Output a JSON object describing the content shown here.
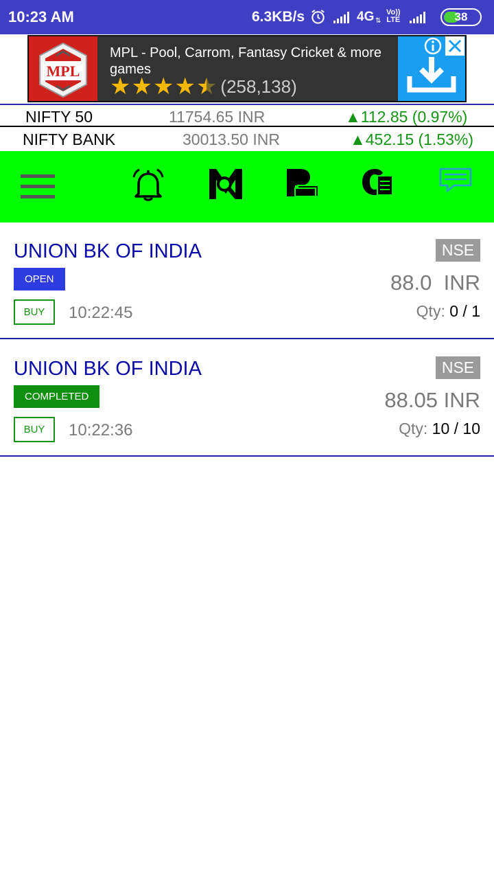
{
  "status_bar": {
    "time": "10:23 AM",
    "speed": "6.3KB/s",
    "network": "4G",
    "volte_line1": "Vo))",
    "volte_line2": "LTE",
    "battery": "38"
  },
  "ad": {
    "title": "MPL - Pool, Carrom, Fantasy Cricket & more games",
    "rating": 4.5,
    "rating_count": "(258,138)",
    "logo_text": "MPL"
  },
  "indices": [
    {
      "name": "NIFTY 50",
      "value": "11754.65 INR",
      "change": "▲112.85 (0.97%)"
    },
    {
      "name": "NIFTY BANK",
      "value": "30013.50 INR",
      "change": "▲452.15 (1.53%)"
    }
  ],
  "toolbar": {
    "icons": [
      "menu-icon",
      "bell-icon",
      "market-search-icon",
      "portfolio-icon",
      "orders-icon",
      "message-icon"
    ]
  },
  "orders": [
    {
      "name": "UNION BK OF INDIA",
      "status": "OPEN",
      "side": "BUY",
      "time": "10:22:45",
      "exchange": "NSE",
      "price": "88.0  INR",
      "qty_label": "Qty: ",
      "qty": "0 / 1"
    },
    {
      "name": "UNION BK OF INDIA",
      "status": "COMPLETED",
      "side": "BUY",
      "time": "10:22:36",
      "exchange": "NSE",
      "price": "88.05 INR",
      "qty_label": "Qty: ",
      "qty": "10 / 10"
    }
  ],
  "colors": {
    "status_bar": "#3f3fc4",
    "toolbar": "#00ff00",
    "name_blue": "#0a0aa8",
    "gain_green": "#149614",
    "open_badge": "#2d3ce0",
    "completed_badge": "#0e8f0e"
  }
}
